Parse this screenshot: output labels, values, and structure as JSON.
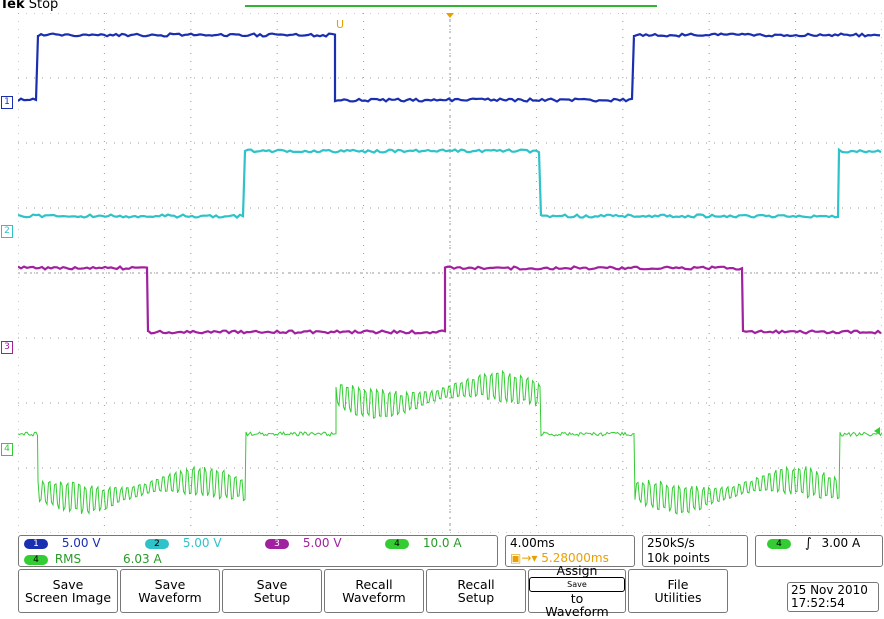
{
  "header": {
    "brand": "Tek",
    "status": "Stop"
  },
  "colors": {
    "ch1": "#1a2fb0",
    "ch2": "#2ec2c9",
    "ch3": "#a020a0",
    "ch4": "#33cc33",
    "trigger": "#e8a000",
    "grid": "#9a9a9a"
  },
  "channels": [
    {
      "id": "1",
      "label": "1",
      "scale": "5.00 V"
    },
    {
      "id": "2",
      "label": "2",
      "scale": "5.00 V"
    },
    {
      "id": "3",
      "label": "3",
      "scale": "5.00 V"
    },
    {
      "id": "4",
      "label": "4",
      "scale": "10.0 A"
    }
  ],
  "measurement": {
    "channel": "4",
    "name": "RMS",
    "value": "6.03 A"
  },
  "timebase": {
    "scale": "4.00ms",
    "delay": "5.28000ms"
  },
  "acquisition": {
    "sample_rate": "250kS/s",
    "record_length": "10k points"
  },
  "trigger": {
    "source": "4",
    "slope_icon": "rising-edge-icon",
    "level": "3.00 A",
    "marker": "U"
  },
  "softkeys": [
    {
      "line1": "Save",
      "line2": "Screen Image"
    },
    {
      "line1": "Save",
      "line2": "Waveform"
    },
    {
      "line1": "Save",
      "line2": "Setup"
    },
    {
      "line1": "Recall",
      "line2": "Waveform"
    },
    {
      "line1": "Recall",
      "line2": "Setup"
    },
    {
      "line1": "Assign",
      "line2_pre": "Save",
      "line2_post": " to",
      "line3": "Waveform"
    },
    {
      "line1": "File",
      "line2": "Utilities"
    }
  ],
  "datetime": {
    "date": "25 Nov 2010",
    "time": "17:52:54"
  }
}
